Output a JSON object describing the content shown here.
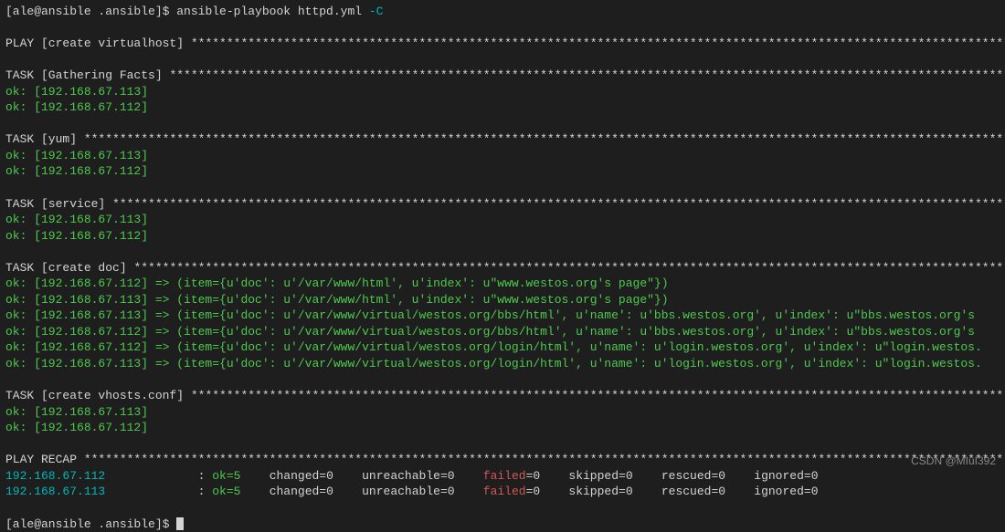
{
  "prompt1": {
    "text": "[ale@ansible .ansible]$ ",
    "cmd": "ansible-playbook httpd.yml ",
    "flag": "-C"
  },
  "play": {
    "label": "PLAY [create virtualhost] "
  },
  "tasks": {
    "gather": {
      "label": "TASK [Gathering Facts] ",
      "hosts": [
        "ok: [192.168.67.113]",
        "ok: [192.168.67.112]"
      ]
    },
    "yum": {
      "label": "TASK [yum] ",
      "hosts": [
        "ok: [192.168.67.113]",
        "ok: [192.168.67.112]"
      ]
    },
    "service": {
      "label": "TASK [service] ",
      "hosts": [
        "ok: [192.168.67.113]",
        "ok: [192.168.67.112]"
      ]
    },
    "createdoc": {
      "label": "TASK [create doc] ",
      "items": [
        "ok: [192.168.67.112] => (item={u'doc': u'/var/www/html', u'index': u\"www.westos.org's page\"})",
        "ok: [192.168.67.113] => (item={u'doc': u'/var/www/html', u'index': u\"www.westos.org's page\"})",
        "ok: [192.168.67.113] => (item={u'doc': u'/var/www/virtual/westos.org/bbs/html', u'name': u'bbs.westos.org', u'index': u\"bbs.westos.org's ",
        "ok: [192.168.67.112] => (item={u'doc': u'/var/www/virtual/westos.org/bbs/html', u'name': u'bbs.westos.org', u'index': u\"bbs.westos.org's ",
        "ok: [192.168.67.112] => (item={u'doc': u'/var/www/virtual/westos.org/login/html', u'name': u'login.westos.org', u'index': u\"login.westos.",
        "ok: [192.168.67.113] => (item={u'doc': u'/var/www/virtual/westos.org/login/html', u'name': u'login.westos.org', u'index': u\"login.westos."
      ]
    },
    "vhosts": {
      "label": "TASK [create vhosts.conf] ",
      "hosts": [
        "ok: [192.168.67.113]",
        "ok: [192.168.67.112]"
      ]
    }
  },
  "recap": {
    "label": "PLAY RECAP ",
    "rows": [
      {
        "host": "192.168.67.112",
        "ok": "ok=5",
        "changed": "changed=0",
        "unreachable": "unreachable=0",
        "failed": "failed",
        "failedeq": "=0",
        "skipped": "skipped=0",
        "rescued": "rescued=0",
        "ignored": "ignored=0"
      },
      {
        "host": "192.168.67.113",
        "ok": "ok=5",
        "changed": "changed=0",
        "unreachable": "unreachable=0",
        "failed": "failed",
        "failedeq": "=0",
        "skipped": "skipped=0",
        "rescued": "rescued=0",
        "ignored": "ignored=0"
      }
    ]
  },
  "prompt2": "[ale@ansible .ansible]$ ",
  "watermark": "CSDN @MIuI392",
  "stars": {
    "play": "**************************************************************************************************************************************",
    "gather": "*****************************************************************************************************************************************",
    "yum": "*************************************************************************************************************************************************",
    "service": "*********************************************************************************************************************************************",
    "createdoc": "******************************************************************************************************************************************",
    "vhosts": "*********************************************************************************************************************************",
    "recap": "*************************************************************************************************************************************************"
  }
}
